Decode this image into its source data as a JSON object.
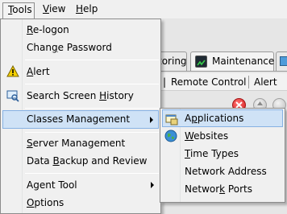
{
  "menubar": {
    "tools": {
      "pre": "",
      "key": "T",
      "post": "ools"
    },
    "view": {
      "pre": "",
      "key": "V",
      "post": "iew"
    },
    "help": {
      "pre": "",
      "key": "H",
      "post": "elp"
    }
  },
  "background": {
    "tab_monitoring": "toring",
    "tab_maintenance": "Maintenance",
    "toolbar_remote_control": "Remote Control",
    "toolbar_alert": "Alert",
    "toolbar_separator": "|"
  },
  "menu": {
    "items": [
      {
        "pre": "",
        "key": "R",
        "post": "e-logon",
        "icon": "none"
      },
      {
        "pre": "Chan",
        "key": "g",
        "post": "e Password",
        "icon": "none"
      },
      {
        "pre": "",
        "key": "A",
        "post": "lert",
        "icon": "warning-icon"
      },
      {
        "pre": "Search Screen ",
        "key": "H",
        "post": "istory",
        "icon": "search-screen-icon"
      },
      {
        "pre": "Classes Management",
        "key": "",
        "post": "",
        "icon": "none",
        "submenu": true
      },
      {
        "pre": "",
        "key": "S",
        "post": "erver Management",
        "icon": "none"
      },
      {
        "pre": "Data ",
        "key": "B",
        "post": "ackup and Review",
        "icon": "none"
      },
      {
        "pre": "Agent Tool",
        "key": "",
        "post": "",
        "icon": "none",
        "submenu": true
      },
      {
        "pre": "",
        "key": "O",
        "post": "ptions",
        "icon": "none"
      }
    ]
  },
  "submenu": {
    "items": [
      {
        "pre": "A",
        "key": "p",
        "post": "plications",
        "icon": "applications-icon"
      },
      {
        "pre": "",
        "key": "W",
        "post": "ebsites",
        "icon": "globe-icon"
      },
      {
        "pre": "",
        "key": "T",
        "post": "ime Types",
        "icon": "none"
      },
      {
        "pre": "Network Address",
        "key": "",
        "post": "",
        "icon": "none"
      },
      {
        "pre": "Networ",
        "key": "k",
        "post": " Ports",
        "icon": "none"
      }
    ]
  },
  "colors": {
    "menu_bg": "#f0f0f0",
    "highlight_bg": "#cfe2f6",
    "highlight_border": "#86b1e3",
    "delete_red": "#d42020"
  }
}
